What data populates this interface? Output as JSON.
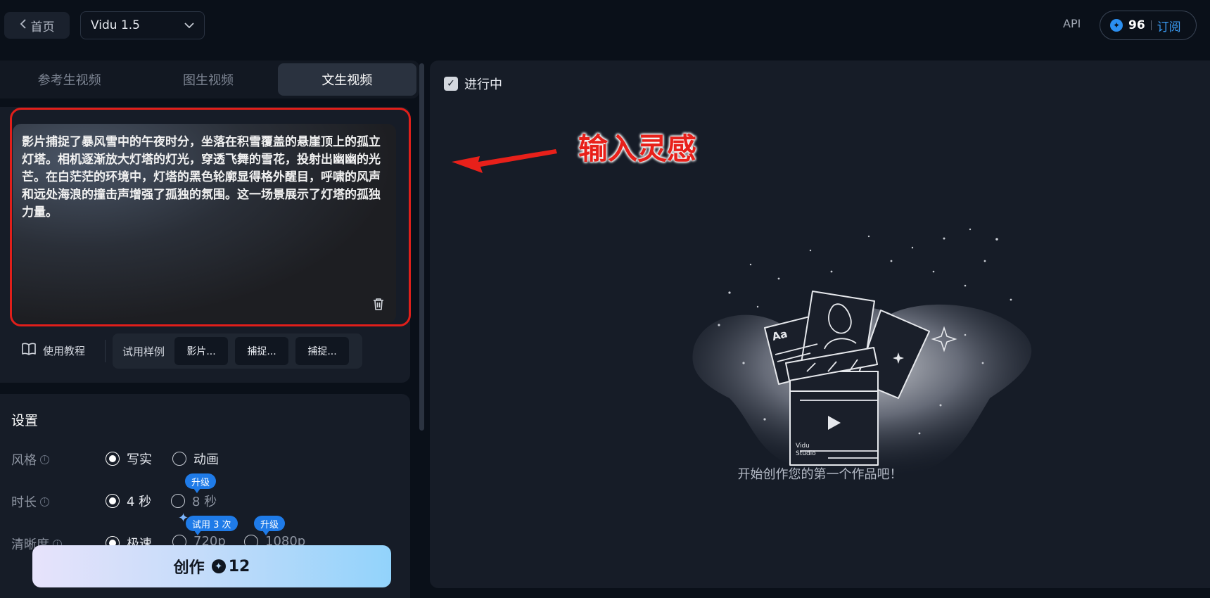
{
  "header": {
    "back_label": "首页",
    "model_name": "Vidu 1.5",
    "api_label": "API",
    "credits": "96",
    "subscribe_label": "订阅"
  },
  "tabs": [
    {
      "label": "参考生视频",
      "active": false
    },
    {
      "label": "图生视频",
      "active": false
    },
    {
      "label": "文生视频",
      "active": true
    }
  ],
  "prompt": {
    "text": "影片捕捉了暴风雪中的午夜时分，坐落在积雪覆盖的悬崖顶上的孤立灯塔。相机逐渐放大灯塔的灯光，穿透飞舞的雪花，投射出幽幽的光芒。在白茫茫的环境中，灯塔的黑色轮廓显得格外醒目，呼啸的风声和远处海浪的撞击声增强了孤独的氛围。这一场景展示了灯塔的孤独力量。"
  },
  "helpers": {
    "tutorial_label": "使用教程",
    "samples_label": "试用样例",
    "samples": [
      "影片...",
      "捕捉...",
      "捕捉..."
    ]
  },
  "settings": {
    "title": "设置",
    "style": {
      "label": "风格",
      "options": [
        "写实",
        "动画"
      ],
      "selected": "写实"
    },
    "duration": {
      "label": "时长",
      "options": [
        "4 秒",
        "8 秒"
      ],
      "selected": "4 秒",
      "badge": "升级"
    },
    "resolution": {
      "label": "清晰度",
      "options": [
        "极速",
        "720p",
        "1080p"
      ],
      "selected": "极速",
      "badge_720": "试用 3 次",
      "badge_1080": "升级"
    }
  },
  "create": {
    "label": "创作",
    "cost": "12"
  },
  "results": {
    "filter_label": "进行中",
    "filter_checked": true,
    "empty_message": "开始创作您的第一个作品吧！"
  },
  "illustration": {
    "card_text": "Aa",
    "brand_line1": "Vidu",
    "brand_line2": "Studio"
  },
  "annotation": {
    "text": "输入灵感"
  },
  "colors": {
    "accent_blue": "#1f7be8",
    "highlight_red": "#e01f1a"
  }
}
